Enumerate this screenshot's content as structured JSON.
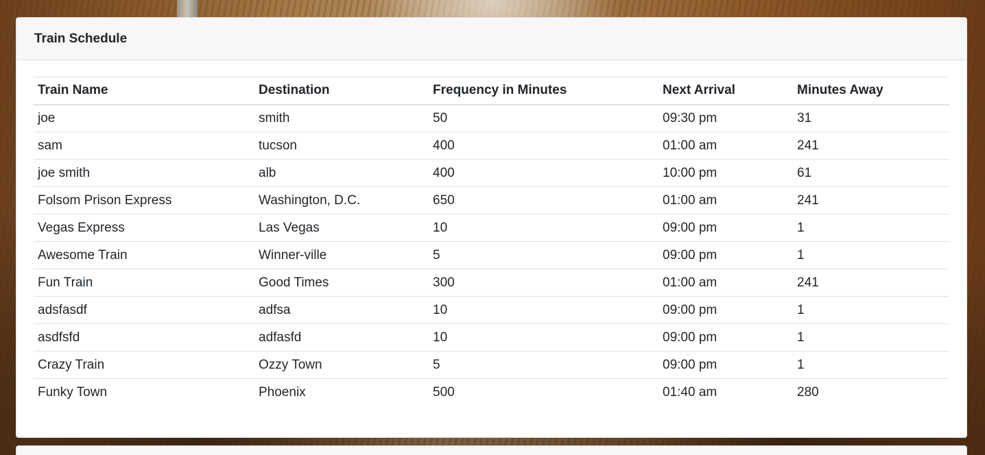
{
  "schedule": {
    "title": "Train Schedule",
    "columns": [
      "Train Name",
      "Destination",
      "Frequency in Minutes",
      "Next Arrival",
      "Minutes Away"
    ],
    "rows": [
      [
        "joe",
        "smith",
        "50",
        "09:30 pm",
        "31"
      ],
      [
        "sam",
        "tucson",
        "400",
        "01:00 am",
        "241"
      ],
      [
        "joe smith",
        "alb",
        "400",
        "10:00 pm",
        "61"
      ],
      [
        "Folsom Prison Express",
        "Washington, D.C.",
        "650",
        "01:00 am",
        "241"
      ],
      [
        "Vegas Express",
        "Las Vegas",
        "10",
        "09:00 pm",
        "1"
      ],
      [
        "Awesome Train",
        "Winner-ville",
        "5",
        "09:00 pm",
        "1"
      ],
      [
        "Fun Train",
        "Good Times",
        "300",
        "01:00 am",
        "241"
      ],
      [
        "adsfasdf",
        "adfsa",
        "10",
        "09:00 pm",
        "1"
      ],
      [
        "asdfsfd",
        "adfasfd",
        "10",
        "09:00 pm",
        "1"
      ],
      [
        "Crazy Train",
        "Ozzy Town",
        "5",
        "09:00 pm",
        "1"
      ],
      [
        "Funky Town",
        "Phoenix",
        "500",
        "01:40 am",
        "280"
      ]
    ]
  }
}
